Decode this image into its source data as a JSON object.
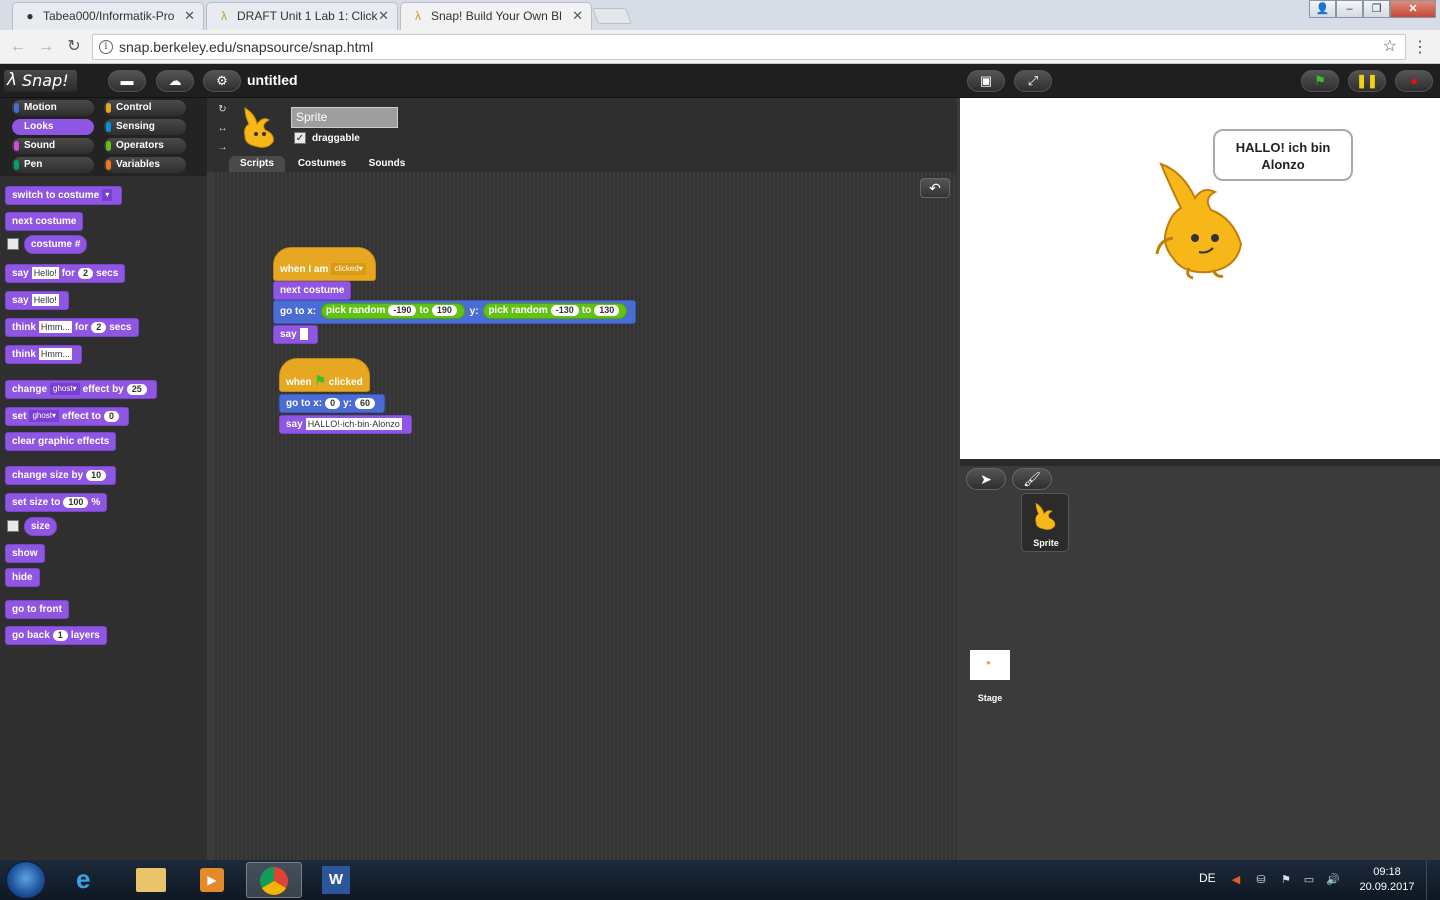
{
  "browser": {
    "tabs": [
      {
        "label": "Tabea000/Informatik-Pro",
        "icon": "github-icon"
      },
      {
        "label": "DRAFT Unit 1 Lab 1: Click",
        "icon": "snap-lambda-icon"
      },
      {
        "label": "Snap! Build Your Own Bl",
        "icon": "snap-lambda-icon"
      }
    ],
    "url": "snap.berkeley.edu/snapsource/snap.html"
  },
  "snap": {
    "logo": "Snap!",
    "project_title": "untitled",
    "categories": [
      {
        "label": "Motion",
        "color": "#4a6cd4"
      },
      {
        "label": "Control",
        "color": "#e6a822"
      },
      {
        "label": "Looks",
        "color": "#8f56e3"
      },
      {
        "label": "Sensing",
        "color": "#0494dc"
      },
      {
        "label": "Sound",
        "color": "#cf4ad9"
      },
      {
        "label": "Operators",
        "color": "#62c213"
      },
      {
        "label": "Pen",
        "color": "#00a178"
      },
      {
        "label": "Variables",
        "color": "#f3761d"
      }
    ],
    "selected_category": "Looks",
    "palette": {
      "switch_costume": "switch to costume",
      "next_costume": "next costume",
      "costume_num": "costume #",
      "say": "say",
      "for": "for",
      "secs": "secs",
      "think": "think",
      "hello": "Hello!",
      "hmm": "Hmm...",
      "two": "2",
      "change": "change",
      "set": "set",
      "ghost": "ghost",
      "effect_by": "effect by",
      "effect_to": "effect to",
      "twentyfive": "25",
      "zero": "0",
      "clear_effects": "clear graphic effects",
      "change_size_by": "change size by",
      "ten": "10",
      "set_size_to": "set size to",
      "hundred": "100",
      "percent": "%",
      "size": "size",
      "show": "show",
      "hide": "hide",
      "go_front": "go to front",
      "go_back": "go back",
      "one": "1",
      "layers": "layers"
    },
    "sprite": {
      "name": "Sprite",
      "draggable_label": "draggable",
      "draggable_checked": "✓",
      "tabs": [
        "Scripts",
        "Costumes",
        "Sounds"
      ],
      "active_tab": "Scripts"
    },
    "script1": {
      "hat_when": "when I am",
      "hat_dd": "clicked",
      "next_costume": "next costume",
      "goto": "go to x:",
      "pick_random": "pick random",
      "to": "to",
      "y": "y:",
      "x_from": "-190",
      "x_to": "190",
      "y_from": "-130",
      "y_to": "130",
      "say": "say",
      "say_value": ""
    },
    "script2": {
      "when": "when",
      "clicked": "clicked",
      "goto": "go to x:",
      "x": "0",
      "y_label": "y:",
      "y": "60",
      "say": "say",
      "say_value": "HALLO!·ich·bin·Alonzo"
    },
    "stage": {
      "speech": "HALLO! ich bin Alonzo",
      "sprite_label": "Sprite",
      "stage_label": "Stage"
    }
  },
  "taskbar": {
    "language": "DE",
    "time": "09:18",
    "date": "20.09.2017"
  }
}
